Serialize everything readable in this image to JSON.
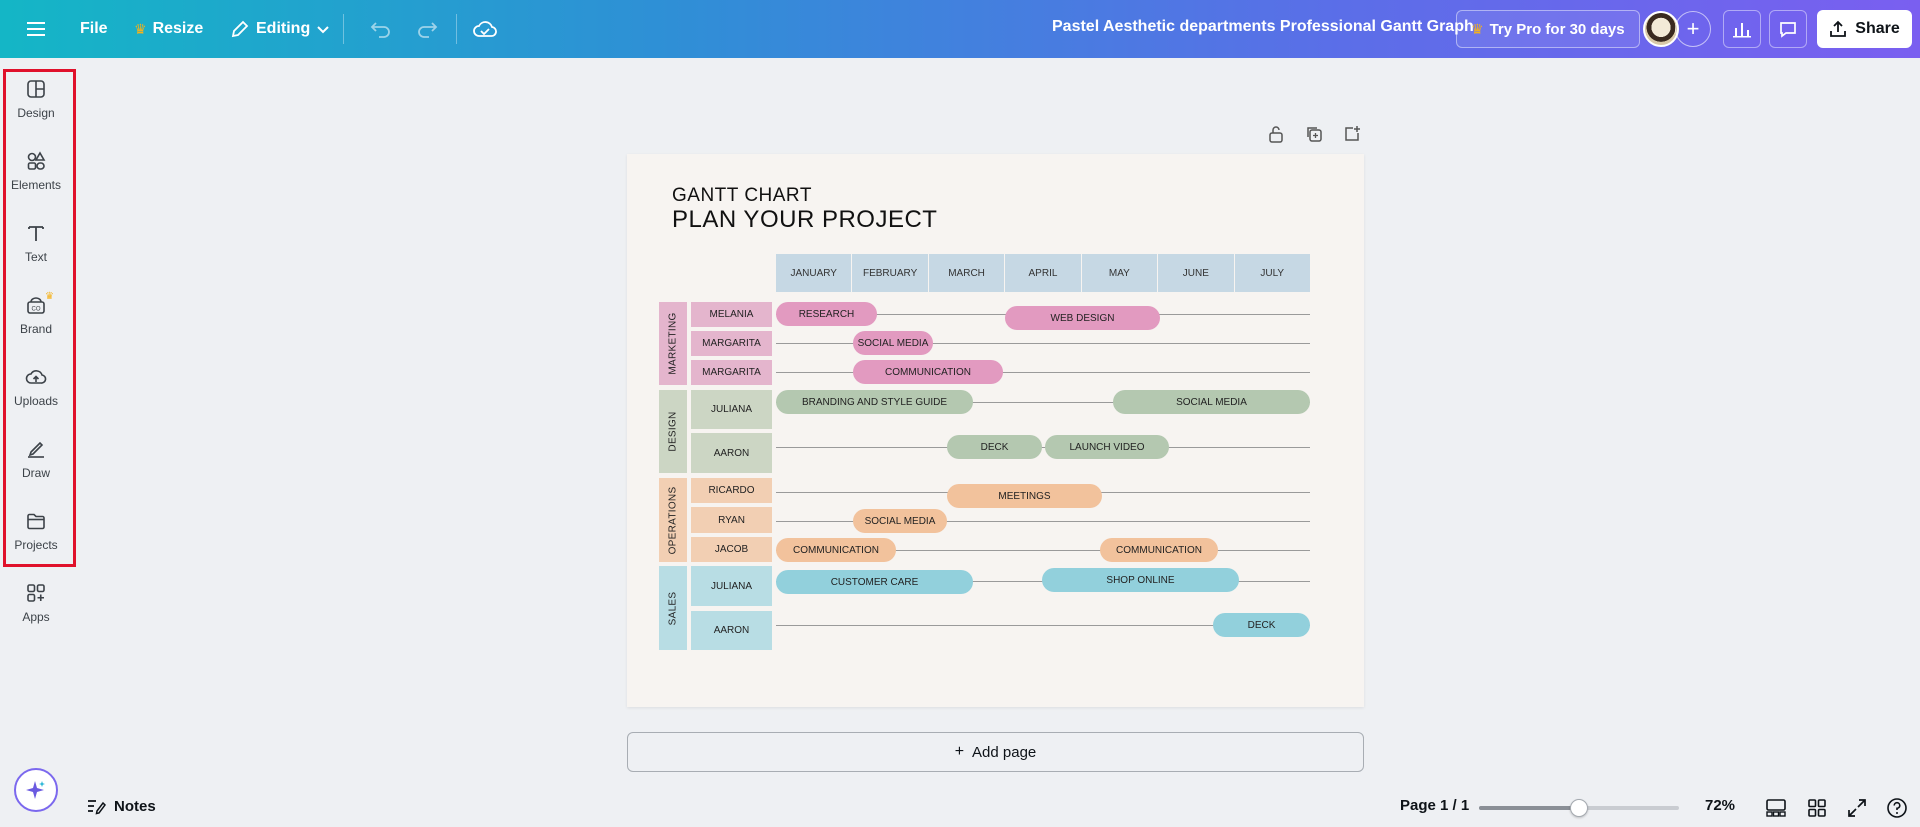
{
  "topbar": {
    "file_label": "File",
    "resize_label": "Resize",
    "editing_label": "Editing",
    "doc_title": "Pastel Aesthetic departments Professional Gantt Graph",
    "pro_label": "Try Pro for 30 days",
    "share_label": "Share"
  },
  "sidebar": {
    "items": [
      {
        "label": "Design",
        "icon": "design-icon"
      },
      {
        "label": "Elements",
        "icon": "elements-icon"
      },
      {
        "label": "Text",
        "icon": "text-icon"
      },
      {
        "label": "Brand",
        "icon": "brand-icon"
      },
      {
        "label": "Uploads",
        "icon": "uploads-icon"
      },
      {
        "label": "Draw",
        "icon": "draw-icon"
      },
      {
        "label": "Projects",
        "icon": "projects-icon"
      },
      {
        "label": "Apps",
        "icon": "apps-icon"
      }
    ]
  },
  "design": {
    "subtitle": "GANTT CHART",
    "title": "PLAN YOUR PROJECT",
    "months": [
      "JANUARY",
      "FEBRUARY",
      "MARCH",
      "APRIL",
      "MAY",
      "JUNE",
      "JULY"
    ],
    "departments": [
      {
        "name": "MARKETING",
        "color": "#e4b5cd"
      },
      {
        "name": "DESIGN",
        "color": "#ccd6c4"
      },
      {
        "name": "OPERATIONS",
        "color": "#f2cfb3"
      },
      {
        "name": "SALES",
        "color": "#b8dde4"
      }
    ],
    "rows": [
      {
        "person": "MELANIA",
        "dept": "MARKETING"
      },
      {
        "person": "MARGARITA",
        "dept": "MARKETING"
      },
      {
        "person": "MARGARITA",
        "dept": "MARKETING"
      },
      {
        "person": "JULIANA",
        "dept": "DESIGN"
      },
      {
        "person": "AARON",
        "dept": "DESIGN"
      },
      {
        "person": "RICARDO",
        "dept": "OPERATIONS"
      },
      {
        "person": "RYAN",
        "dept": "OPERATIONS"
      },
      {
        "person": "JACOB",
        "dept": "OPERATIONS"
      },
      {
        "person": "JULIANA",
        "dept": "SALES"
      },
      {
        "person": "AARON",
        "dept": "SALES"
      }
    ],
    "tasks": [
      {
        "label": "RESEARCH",
        "dept": "MARKETING"
      },
      {
        "label": "WEB DESIGN",
        "dept": "MARKETING"
      },
      {
        "label": "SOCIAL MEDIA",
        "dept": "MARKETING"
      },
      {
        "label": "COMMUNICATION",
        "dept": "MARKETING"
      },
      {
        "label": "BRANDING AND STYLE GUIDE",
        "dept": "DESIGN"
      },
      {
        "label": "SOCIAL MEDIA",
        "dept": "DESIGN"
      },
      {
        "label": "DECK",
        "dept": "DESIGN"
      },
      {
        "label": "LAUNCH VIDEO",
        "dept": "DESIGN"
      },
      {
        "label": "MEETINGS",
        "dept": "OPERATIONS"
      },
      {
        "label": "SOCIAL MEDIA",
        "dept": "OPERATIONS"
      },
      {
        "label": "COMMUNICATION",
        "dept": "OPERATIONS"
      },
      {
        "label": "COMMUNICATION",
        "dept": "OPERATIONS"
      },
      {
        "label": "CUSTOMER CARE",
        "dept": "SALES"
      },
      {
        "label": "SHOP ONLINE",
        "dept": "SALES"
      },
      {
        "label": "DECK",
        "dept": "SALES"
      }
    ],
    "bar_colors": {
      "MARKETING": "#e29ac0",
      "DESIGN": "#b4c8b0",
      "OPERATIONS": "#f2c29c",
      "SALES": "#92d0dc"
    }
  },
  "canvas": {
    "add_page_label": "Add page"
  },
  "bottombar": {
    "notes_label": "Notes",
    "page_info": "Page 1 / 1",
    "zoom_label": "72%",
    "zoom_level_fraction": 0.5
  },
  "colors": {
    "accent_gradient_start": "#14b6c6",
    "accent_gradient_end": "#7a5ff0",
    "highlight_border": "#e0112b",
    "crown": "#f5b21b"
  }
}
